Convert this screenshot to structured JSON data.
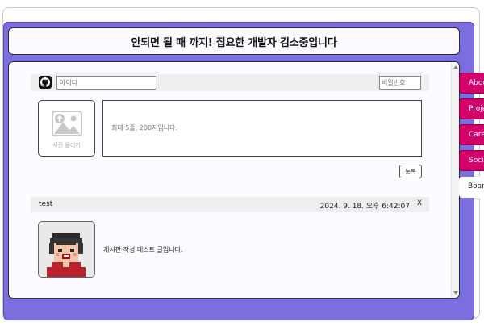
{
  "title": "안되면 될 때 까지! 집요한 개발자 김소중입니다",
  "login": {
    "id_placeholder": "아이디",
    "password_placeholder": "비밀번호"
  },
  "composer": {
    "photo_label": "사진 올리기",
    "text_placeholder": "최대 5줄, 200자입니다.",
    "submit_label": "등록"
  },
  "post": {
    "author": "test",
    "date": "2024. 9. 18. 오후 6:42:07",
    "delete_label": "X",
    "body": "게시판 작성 테스트 글입니다."
  },
  "side_tabs": [
    {
      "label": "About"
    },
    {
      "label": "Projects"
    },
    {
      "label": "Career"
    },
    {
      "label": "Social"
    },
    {
      "label": "Board"
    }
  ],
  "colors": {
    "panel": "#7b6fe0",
    "tab": "#d4006b"
  }
}
